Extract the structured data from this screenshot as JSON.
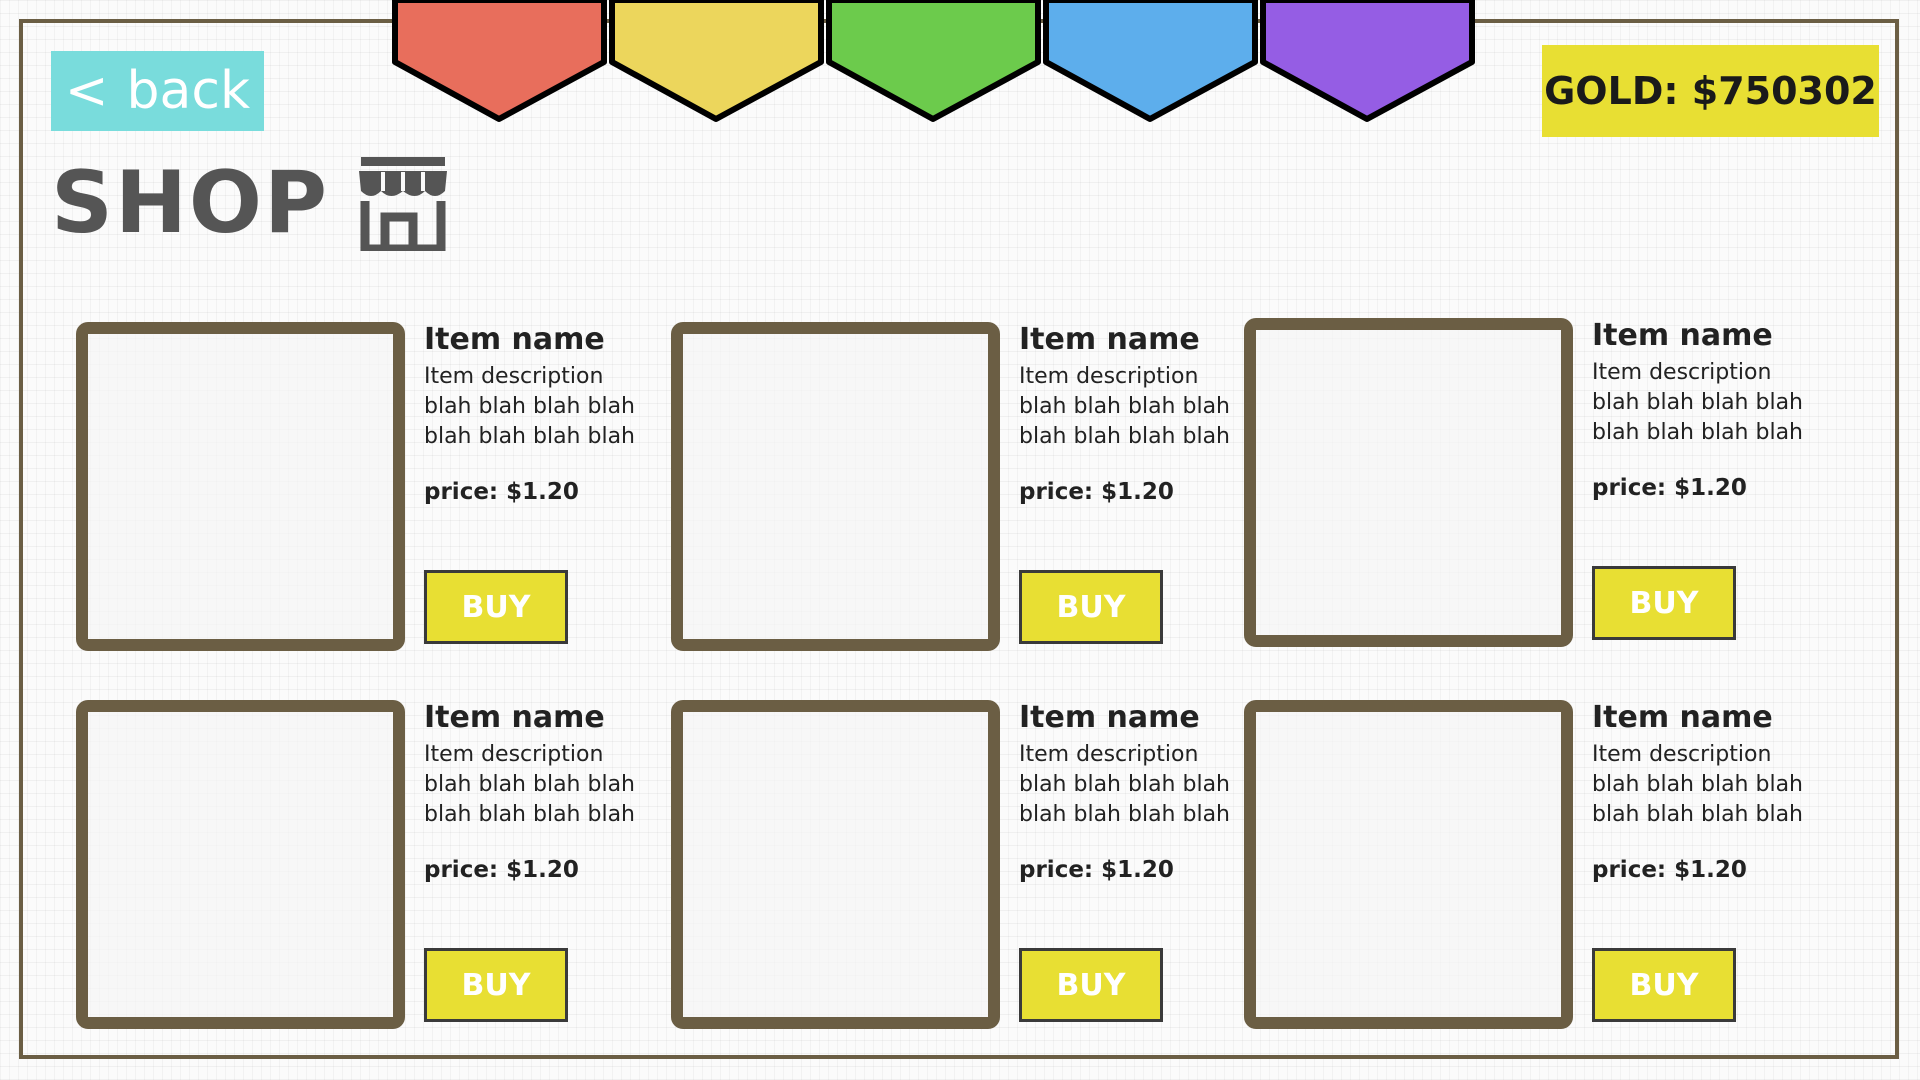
{
  "tabs": [
    {
      "name": "red",
      "color": "#e86e5c"
    },
    {
      "name": "yellow",
      "color": "#ecd65c"
    },
    {
      "name": "green",
      "color": "#6ccb4c"
    },
    {
      "name": "blue",
      "color": "#5daeec"
    },
    {
      "name": "purple",
      "color": "#955de4"
    }
  ],
  "back": {
    "chevron": "<",
    "label": "back"
  },
  "gold": {
    "text": "GOLD: $750302"
  },
  "shop": {
    "title": "SHOP",
    "icon": "store-icon"
  },
  "items": [
    {
      "name": "Item name",
      "desc_line1": "Item description",
      "desc_line2": "blah blah blah blah",
      "desc_line3": "blah blah blah blah",
      "price": "price: $1.20",
      "buy_label": "BUY"
    },
    {
      "name": "Item name",
      "desc_line1": "Item description",
      "desc_line2": "blah blah blah blah",
      "desc_line3": "blah blah blah blah",
      "price": "price: $1.20",
      "buy_label": "BUY"
    },
    {
      "name": "Item name",
      "desc_line1": "Item description",
      "desc_line2": "blah blah blah blah",
      "desc_line3": "blah blah blah blah",
      "price": "price: $1.20",
      "buy_label": "BUY"
    },
    {
      "name": "Item name",
      "desc_line1": "Item description",
      "desc_line2": "blah blah blah blah",
      "desc_line3": "blah blah blah blah",
      "price": "price: $1.20",
      "buy_label": "BUY"
    },
    {
      "name": "Item name",
      "desc_line1": "Item description",
      "desc_line2": "blah blah blah blah",
      "desc_line3": "blah blah blah blah",
      "price": "price: $1.20",
      "buy_label": "BUY"
    },
    {
      "name": "Item name",
      "desc_line1": "Item description",
      "desc_line2": "blah blah blah blah",
      "desc_line3": "blah blah blah blah",
      "price": "price: $1.20",
      "buy_label": "BUY"
    }
  ],
  "colors": {
    "frame": "#6b5e44",
    "gold_bg": "#e8df33",
    "back_bg": "#79dcdc",
    "buy_bg": "#e8df33"
  }
}
